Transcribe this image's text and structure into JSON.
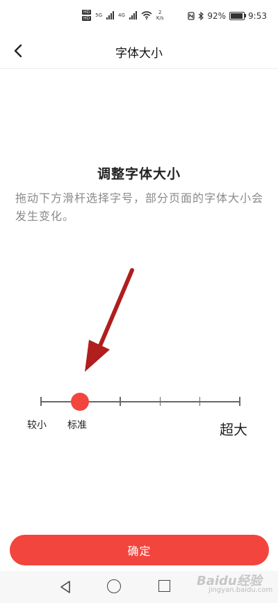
{
  "status_bar": {
    "hd1": "HD",
    "hd2": "HD",
    "net1": "5G",
    "net2": "4G",
    "speed_value": "2",
    "speed_unit": "K/s",
    "battery": "92%",
    "time": "9:53",
    "battery_level": 0.92
  },
  "header": {
    "title": "字体大小"
  },
  "main": {
    "heading": "调整字体大小",
    "description": "拖动下方滑杆选择字号，部分页面的字体大小会发生变化。"
  },
  "slider": {
    "steps": 6,
    "selected_index": 1,
    "label_small": "较小",
    "label_standard": "标准",
    "label_large": "超大",
    "accent": "#f2453d"
  },
  "footer": {
    "confirm_label": "确定"
  },
  "watermark": {
    "text": "Baidu经验",
    "sub": "jingyan.baidu.com"
  }
}
